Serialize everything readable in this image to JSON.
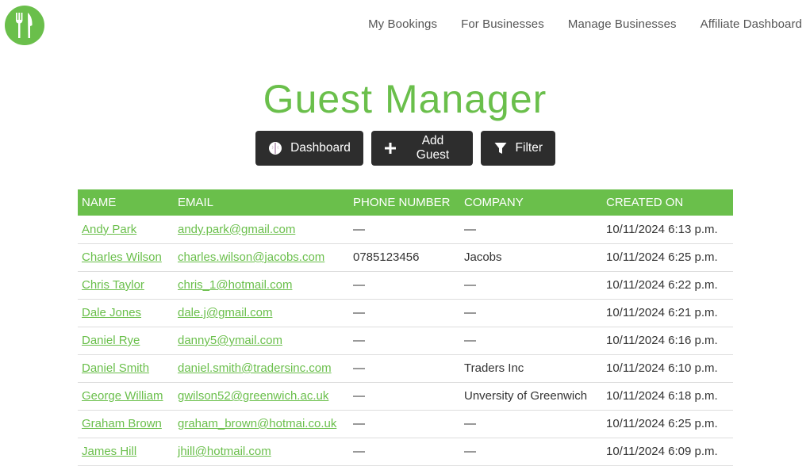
{
  "brand": {
    "logo_icon": "fork-knife-icon",
    "accent_color": "#6abf4b"
  },
  "nav": {
    "items": [
      {
        "label": "My Bookings"
      },
      {
        "label": "For Businesses"
      },
      {
        "label": "Manage Businesses"
      },
      {
        "label": "Affiliate Dashboard"
      }
    ]
  },
  "page": {
    "title": "Guest Manager"
  },
  "actions": {
    "dashboard": {
      "label": "Dashboard",
      "icon": "brain-icon"
    },
    "add_guest": {
      "label": "Add Guest",
      "icon": "plus-icon"
    },
    "filter": {
      "label": "Filter",
      "icon": "filter-icon"
    }
  },
  "table": {
    "headers": [
      "NAME",
      "EMAIL",
      "PHONE NUMBER",
      "COMPANY",
      "CREATED ON"
    ],
    "rows": [
      {
        "name": "Andy Park",
        "email": "andy.park@gmail.com",
        "phone": "—",
        "company": "—",
        "created": "10/11/2024 6:13 p.m."
      },
      {
        "name": "Charles Wilson",
        "email": "charles.wilson@jacobs.com",
        "phone": "0785123456",
        "company": "Jacobs",
        "created": "10/11/2024 6:25 p.m."
      },
      {
        "name": "Chris Taylor",
        "email": "chris_1@hotmail.com",
        "phone": "—",
        "company": "—",
        "created": "10/11/2024 6:22 p.m."
      },
      {
        "name": "Dale Jones",
        "email": "dale.j@gmail.com",
        "phone": "—",
        "company": "—",
        "created": "10/11/2024 6:21 p.m."
      },
      {
        "name": "Daniel Rye",
        "email": "danny5@ymail.com",
        "phone": "—",
        "company": "—",
        "created": "10/11/2024 6:16 p.m."
      },
      {
        "name": "Daniel Smith",
        "email": "daniel.smith@tradersinc.com",
        "phone": "—",
        "company": "Traders Inc",
        "created": "10/11/2024 6:10 p.m."
      },
      {
        "name": "George William",
        "email": "gwilson52@greenwich.ac.uk",
        "phone": "—",
        "company": "Unversity of Greenwich",
        "created": "10/11/2024 6:18 p.m."
      },
      {
        "name": "Graham Brown",
        "email": "graham_brown@hotmai.co.uk",
        "phone": "—",
        "company": "—",
        "created": "10/11/2024 6:25 p.m."
      },
      {
        "name": "James Hill",
        "email": "jhill@hotmail.com",
        "phone": "—",
        "company": "—",
        "created": "10/11/2024 6:09 p.m."
      }
    ]
  }
}
